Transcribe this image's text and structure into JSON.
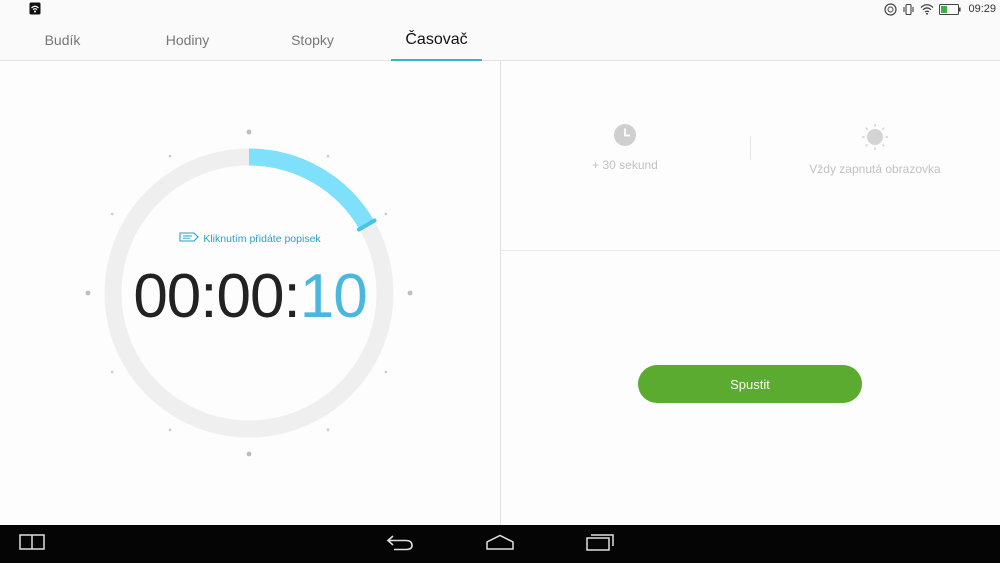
{
  "status_bar": {
    "time": "09:29",
    "battery_color": "#3cb043"
  },
  "tabs": [
    {
      "label": "Budík",
      "active": false
    },
    {
      "label": "Hodiny",
      "active": false
    },
    {
      "label": "Stopky",
      "active": false
    },
    {
      "label": "Časovač",
      "active": true
    }
  ],
  "timer": {
    "label_hint": "Kliknutím přidáte popisek",
    "hours": "00",
    "minutes": "00",
    "seconds": "10",
    "separator": ":",
    "arc_color": "#7fe0fb"
  },
  "options": {
    "add_time": {
      "label": "+ 30 sekund",
      "icon": "clock-icon"
    },
    "screen_on": {
      "label": "Vždy zapnutá obrazovka",
      "icon": "sun-icon"
    }
  },
  "start_button": {
    "label": "Spustit",
    "color": "#5aab2f"
  },
  "nav_bar": {
    "icons": [
      "multiwindow-icon",
      "back-icon",
      "home-icon",
      "recent-apps-icon"
    ]
  }
}
